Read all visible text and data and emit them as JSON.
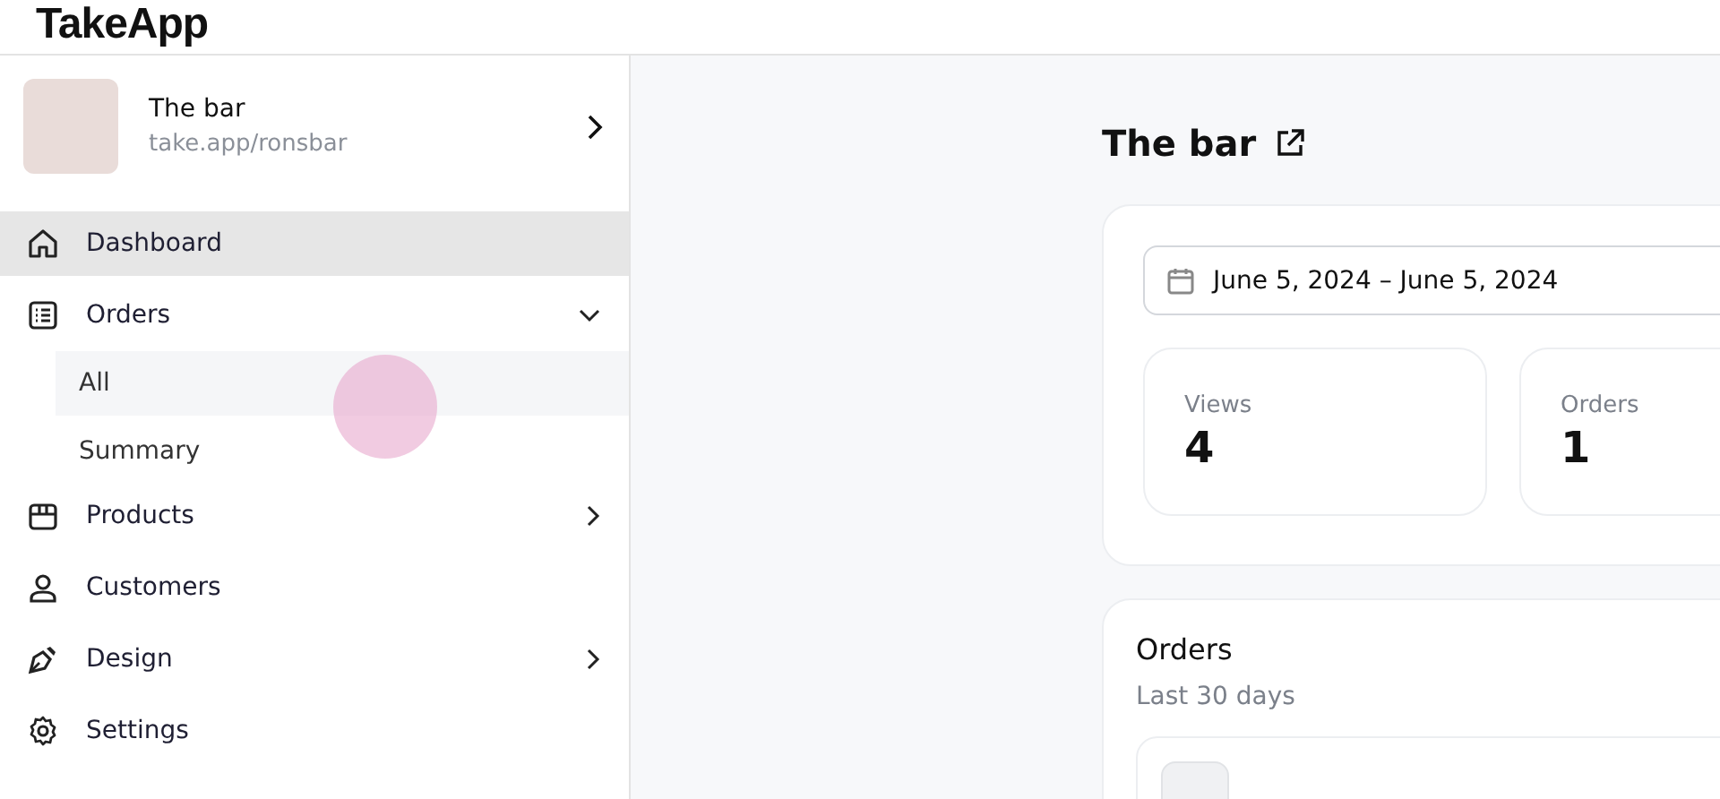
{
  "header": {
    "logo": "TakeApp"
  },
  "store": {
    "name": "The bar",
    "url": "take.app/ronsbar"
  },
  "nav": [
    {
      "label": "Dashboard",
      "selected": true
    },
    {
      "label": "Orders",
      "selected": false,
      "expanded": true,
      "children": [
        {
          "label": "All",
          "selected": true
        },
        {
          "label": "Summary",
          "selected": false
        }
      ]
    },
    {
      "label": "Products",
      "selected": false,
      "expanded": false
    },
    {
      "label": "Customers",
      "selected": false
    },
    {
      "label": "Design",
      "selected": false,
      "expanded": false
    },
    {
      "label": "Settings",
      "selected": false
    }
  ],
  "main": {
    "title": "The bar",
    "date_range": "June 5, 2024 – June 5, 2024",
    "stats": [
      {
        "label": "Views",
        "value": "4"
      },
      {
        "label": "Orders",
        "value": "1"
      }
    ],
    "orders_card": {
      "title": "Orders",
      "subtitle": "Last 30 days"
    }
  }
}
